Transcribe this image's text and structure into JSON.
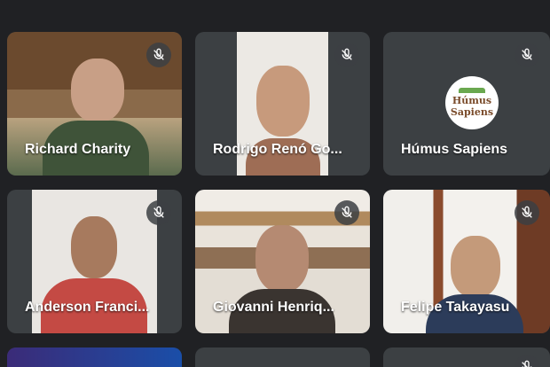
{
  "tiles": [
    {
      "name": "Richard Charity"
    },
    {
      "name": "Rodrigo Renó Go..."
    },
    {
      "name": "Húmus Sapiens"
    },
    {
      "name": "Anderson Franci..."
    },
    {
      "name": "Giovanni Henriq..."
    },
    {
      "name": "Felipe Takayasu"
    }
  ],
  "logo": {
    "line1": "Húmus",
    "line2": "Sapiens"
  },
  "icons": {
    "mic_off": "mic-off-icon"
  },
  "colors": {
    "background": "#202124",
    "tile": "#3c4043"
  }
}
